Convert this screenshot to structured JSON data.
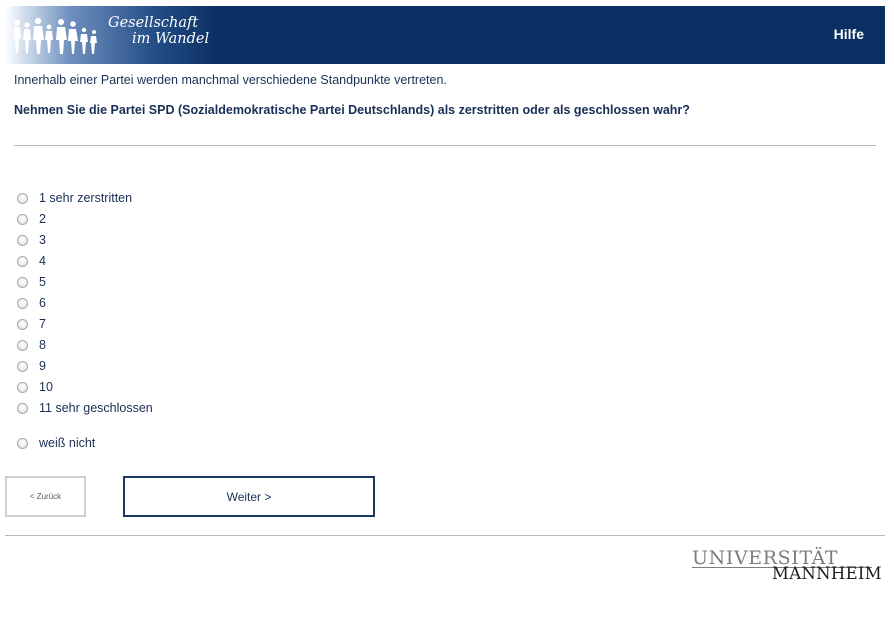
{
  "header": {
    "logo_line1": "Gesellschaft",
    "logo_line2": "im Wandel",
    "help_label": "Hilfe"
  },
  "question": {
    "intro": "Innerhalb einer Partei werden manchmal verschiedene Standpunkte vertreten.",
    "text": "Nehmen Sie die Partei SPD (Sozialdemokratische Partei Deutschlands) als zerstritten oder als geschlossen wahr?"
  },
  "options": [
    {
      "label": "1 sehr zerstritten"
    },
    {
      "label": "2"
    },
    {
      "label": "3"
    },
    {
      "label": "4"
    },
    {
      "label": "5"
    },
    {
      "label": "6"
    },
    {
      "label": "7"
    },
    {
      "label": "8"
    },
    {
      "label": "9"
    },
    {
      "label": "10"
    },
    {
      "label": "11 sehr geschlossen"
    },
    {
      "label": "weiß nicht"
    }
  ],
  "navigation": {
    "back_label": "< Zurück",
    "next_label": "Weiter >"
  },
  "footer": {
    "logo_top": "UNIVERSITÄT",
    "logo_bottom": "MANNHEIM"
  },
  "colors": {
    "header_bg": "#0a2f62",
    "text": "#1a2f55"
  }
}
